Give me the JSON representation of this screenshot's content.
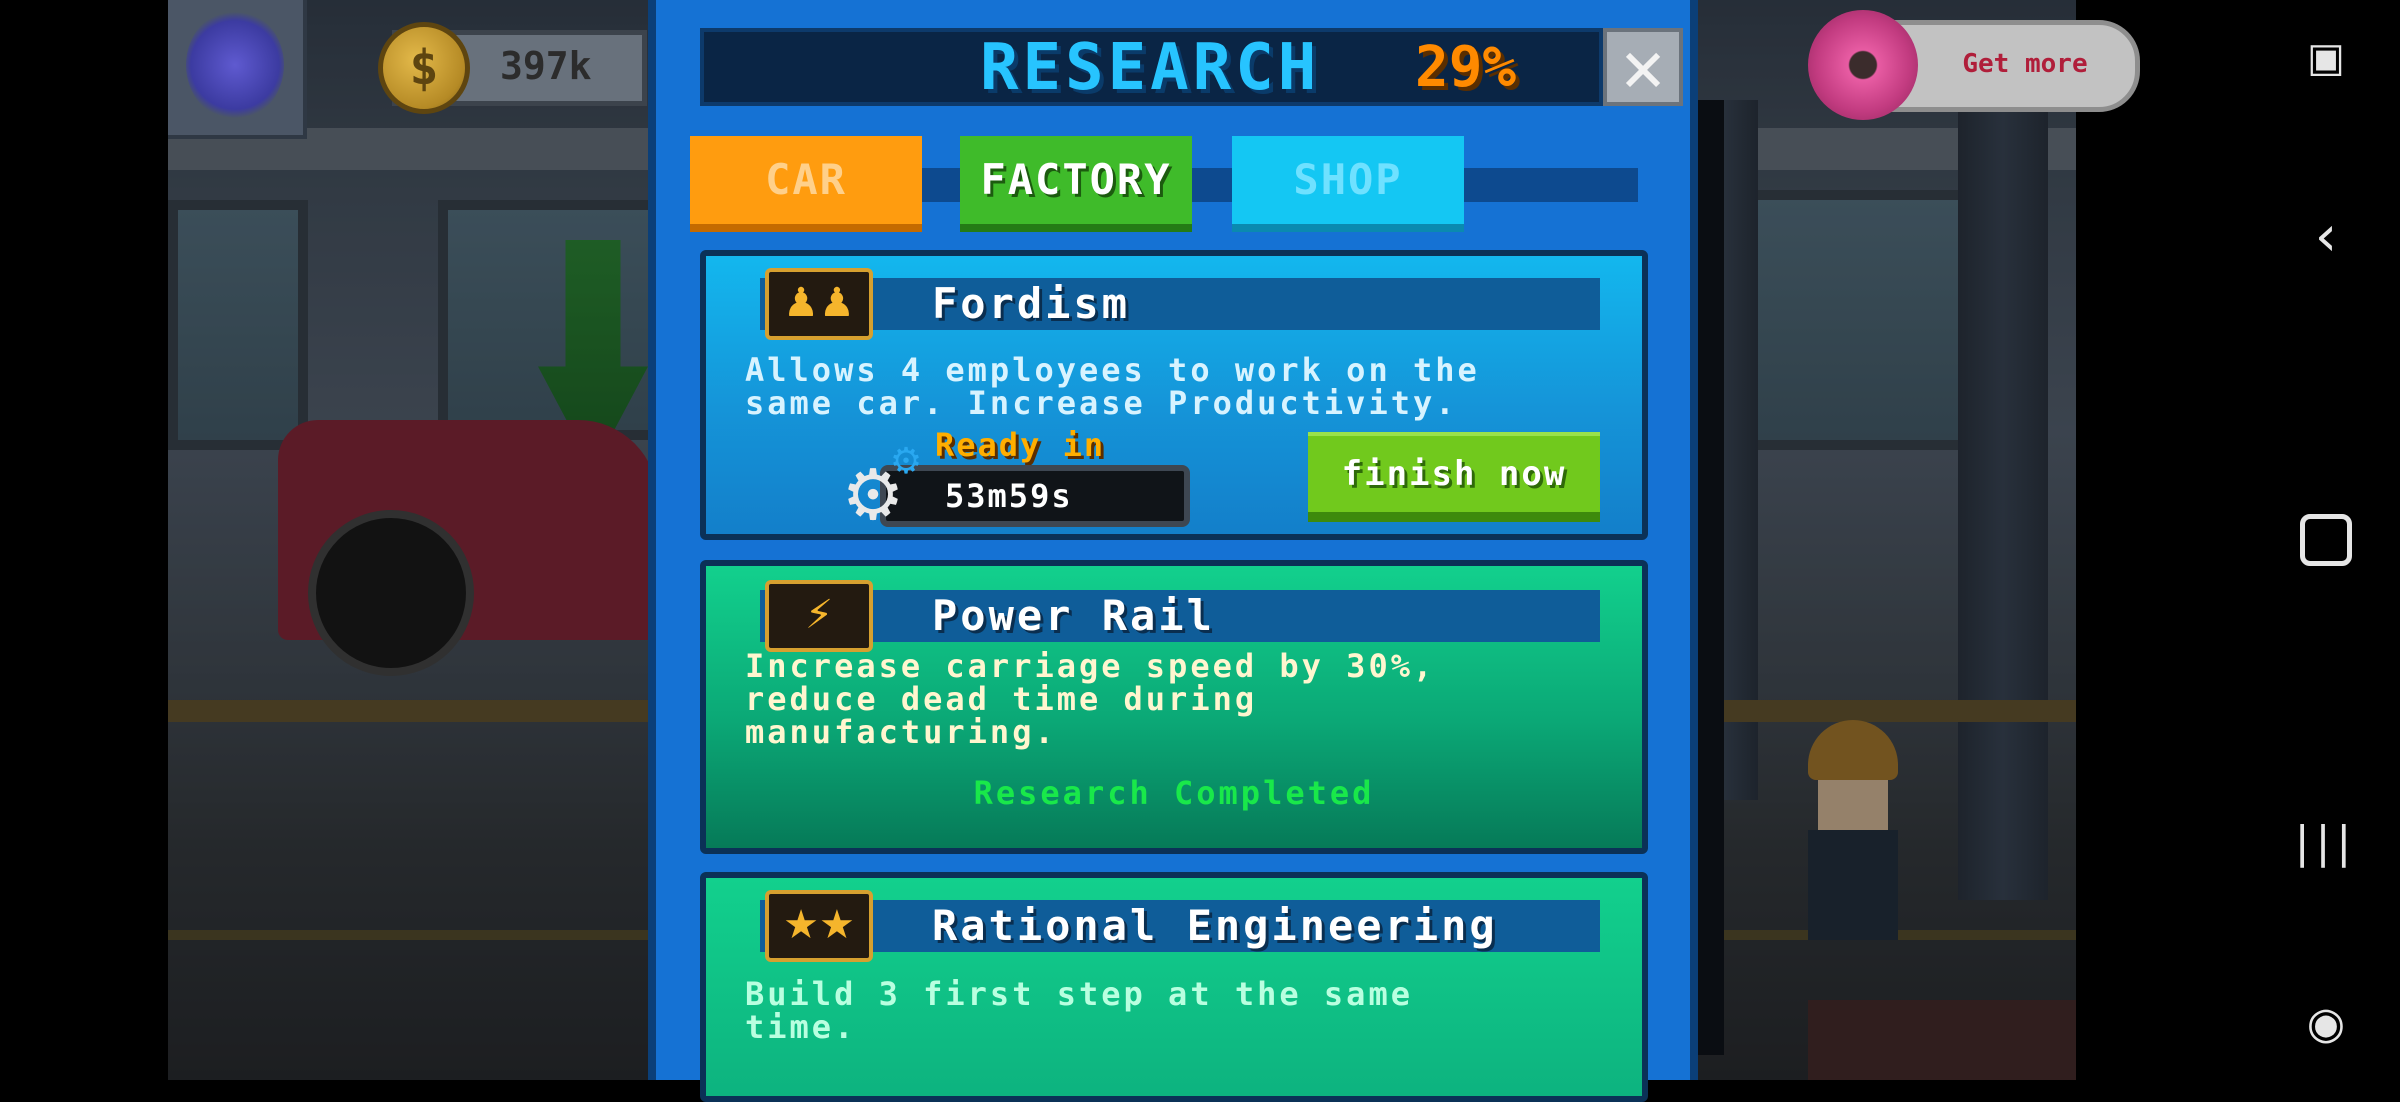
{
  "hud": {
    "coins": "397k",
    "coin_symbol": "$",
    "get_more": "Get more"
  },
  "research": {
    "title": "RESEARCH",
    "percent": "29%",
    "close_glyph": "✕",
    "tabs": [
      {
        "label": "CAR"
      },
      {
        "label": "FACTORY"
      },
      {
        "label": "SHOP"
      }
    ],
    "items": [
      {
        "title": "Fordism",
        "icon": "workers-icon",
        "description": "Allows 4 employees to work on the\nsame car. Increase Productivity.",
        "ready_label": "Ready in",
        "timer": "53m59s",
        "finish_label": "finish now"
      },
      {
        "title": "Power Rail",
        "icon": "power-rail-icon",
        "description": "Increase carriage speed by 30%,\nreduce dead time during\nmanufacturing.",
        "status": "Research Completed"
      },
      {
        "title": "Rational Engineering",
        "icon": "engineering-icon",
        "description": "Build 3 first step at the same time."
      }
    ]
  },
  "colors": {
    "panel": "#1572d4",
    "tab_car": "#ff9c0f",
    "tab_factory": "#3fbb2a",
    "tab_shop": "#14c7f3",
    "title": "#27c4ff",
    "percent": "#ff8a00",
    "completed": "#19e84a"
  }
}
